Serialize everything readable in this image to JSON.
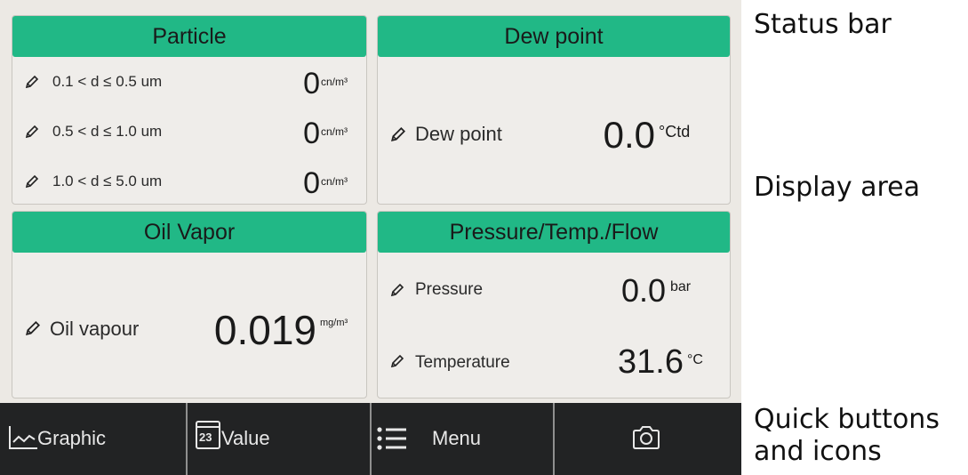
{
  "panels": {
    "particle": {
      "title": "Particle",
      "rows": [
        {
          "label": "0.1 < d ≤ 0.5 um",
          "value": "0",
          "unit": "cn/m³"
        },
        {
          "label": "0.5 < d ≤ 1.0 um",
          "value": "0",
          "unit": "cn/m³"
        },
        {
          "label": "1.0 < d ≤ 5.0 um",
          "value": "0",
          "unit": "cn/m³"
        }
      ]
    },
    "dew": {
      "title": "Dew point",
      "rows": [
        {
          "label": "Dew point",
          "value": "0.0",
          "unit": "°Ctd"
        }
      ]
    },
    "oil": {
      "title": "Oil Vapor",
      "rows": [
        {
          "label": "Oil vapour",
          "value": "0.019",
          "unit": "mg/m³"
        }
      ]
    },
    "ptf": {
      "title": "Pressure/Temp./Flow",
      "rows": [
        {
          "label": "Pressure",
          "value": "0.0",
          "unit": "bar"
        },
        {
          "label": "Temperature",
          "value": "31.6",
          "unit": "°C"
        }
      ]
    }
  },
  "quick_buttons": {
    "graphic": {
      "label": "Graphic",
      "icon": "line-chart-icon"
    },
    "value": {
      "label": "Value",
      "icon_text": "23",
      "icon": "calendar-icon"
    },
    "menu": {
      "label": "Menu",
      "icon": "menu-list-icon"
    },
    "camera": {
      "icon": "camera-icon"
    }
  },
  "annotations": {
    "status_bar": "Status bar",
    "display_area": "Display area",
    "quick_line1": "Quick buttons",
    "quick_line2": "and icons"
  },
  "colors": {
    "header_green": "#21b886",
    "panel_bg": "#efedea",
    "quickbar_bg": "#222324"
  }
}
